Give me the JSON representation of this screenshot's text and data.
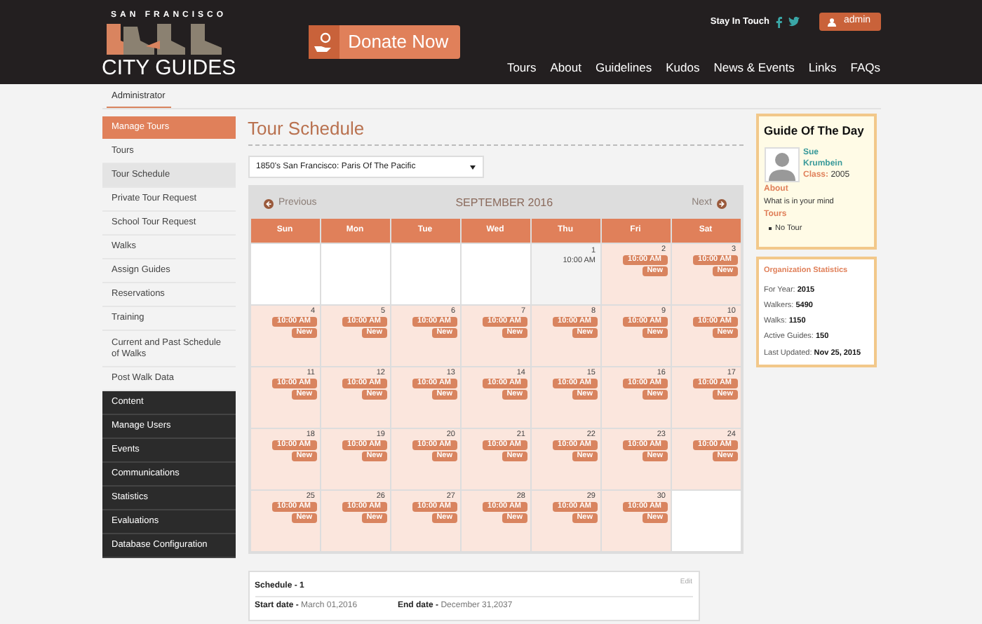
{
  "header": {
    "logo_top": "SAN FRANCISCO",
    "logo_bottom": "CITY GUIDES",
    "donate": "Donate Now",
    "stay_in_touch": "Stay In Touch",
    "user": "admin",
    "nav": [
      "Tours",
      "About",
      "Guidelines",
      "Kudos",
      "News & Events",
      "Links",
      "FAQs"
    ]
  },
  "breadcrumb_tab": "Administrator",
  "sidebar": [
    {
      "label": "Manage Tours",
      "kind": "heading"
    },
    {
      "label": "Tours",
      "kind": "sub",
      "selected": false
    },
    {
      "label": "Tour Schedule",
      "kind": "sub",
      "selected": true
    },
    {
      "label": "Private Tour Request",
      "kind": "sub",
      "selected": false
    },
    {
      "label": "School Tour Request",
      "kind": "sub",
      "selected": false
    },
    {
      "label": "Walks",
      "kind": "sub",
      "selected": false
    },
    {
      "label": "Assign Guides",
      "kind": "sub",
      "selected": false
    },
    {
      "label": "Reservations",
      "kind": "sub",
      "selected": false
    },
    {
      "label": "Training",
      "kind": "sub",
      "selected": false
    },
    {
      "label": "Current and Past Schedule of Walks",
      "kind": "sub",
      "selected": false
    },
    {
      "label": "Post Walk Data",
      "kind": "sub",
      "selected": false
    },
    {
      "label": "Content",
      "kind": "section"
    },
    {
      "label": "Manage Users",
      "kind": "section"
    },
    {
      "label": "Events",
      "kind": "section"
    },
    {
      "label": "Communications",
      "kind": "section"
    },
    {
      "label": "Statistics",
      "kind": "section"
    },
    {
      "label": "Evaluations",
      "kind": "section"
    },
    {
      "label": "Database Configuration",
      "kind": "section"
    }
  ],
  "title": "Tour Schedule",
  "tour_select": {
    "value": "1850's San Francisco: Paris Of The Pacific"
  },
  "calendar": {
    "previous": "Previous",
    "month": "SEPTEMBER 2016",
    "next": "Next",
    "weekdays": [
      "Sun",
      "Mon",
      "Tue",
      "Wed",
      "Thu",
      "Fri",
      "Sat"
    ],
    "weeks": [
      [
        {
          "kind": "blank"
        },
        {
          "kind": "blank"
        },
        {
          "kind": "blank"
        },
        {
          "kind": "blank"
        },
        {
          "kind": "plain",
          "day": "1",
          "time": "10:00 AM"
        },
        {
          "kind": "event",
          "day": "2",
          "time": "10:00 AM",
          "badge": "New"
        },
        {
          "kind": "event",
          "day": "3",
          "time": "10:00 AM",
          "badge": "New"
        }
      ],
      [
        {
          "kind": "event",
          "day": "4",
          "time": "10:00 AM",
          "badge": "New"
        },
        {
          "kind": "event",
          "day": "5",
          "time": "10:00 AM",
          "badge": "New"
        },
        {
          "kind": "event",
          "day": "6",
          "time": "10:00 AM",
          "badge": "New"
        },
        {
          "kind": "event",
          "day": "7",
          "time": "10:00 AM",
          "badge": "New"
        },
        {
          "kind": "event",
          "day": "8",
          "time": "10:00 AM",
          "badge": "New"
        },
        {
          "kind": "event",
          "day": "9",
          "time": "10:00 AM",
          "badge": "New"
        },
        {
          "kind": "event",
          "day": "10",
          "time": "10:00 AM",
          "badge": "New"
        }
      ],
      [
        {
          "kind": "event",
          "day": "11",
          "time": "10:00 AM",
          "badge": "New"
        },
        {
          "kind": "event",
          "day": "12",
          "time": "10:00 AM",
          "badge": "New"
        },
        {
          "kind": "event",
          "day": "13",
          "time": "10:00 AM",
          "badge": "New"
        },
        {
          "kind": "event",
          "day": "14",
          "time": "10:00 AM",
          "badge": "New"
        },
        {
          "kind": "event",
          "day": "15",
          "time": "10:00 AM",
          "badge": "New"
        },
        {
          "kind": "event",
          "day": "16",
          "time": "10:00 AM",
          "badge": "New"
        },
        {
          "kind": "event",
          "day": "17",
          "time": "10:00 AM",
          "badge": "New"
        }
      ],
      [
        {
          "kind": "event",
          "day": "18",
          "time": "10:00 AM",
          "badge": "New"
        },
        {
          "kind": "event",
          "day": "19",
          "time": "10:00 AM",
          "badge": "New"
        },
        {
          "kind": "event",
          "day": "20",
          "time": "10:00 AM",
          "badge": "New"
        },
        {
          "kind": "event",
          "day": "21",
          "time": "10:00 AM",
          "badge": "New"
        },
        {
          "kind": "event",
          "day": "22",
          "time": "10:00 AM",
          "badge": "New"
        },
        {
          "kind": "event",
          "day": "23",
          "time": "10:00 AM",
          "badge": "New"
        },
        {
          "kind": "event",
          "day": "24",
          "time": "10:00 AM",
          "badge": "New"
        }
      ],
      [
        {
          "kind": "event",
          "day": "25",
          "time": "10:00 AM",
          "badge": "New"
        },
        {
          "kind": "event",
          "day": "26",
          "time": "10:00 AM",
          "badge": "New"
        },
        {
          "kind": "event",
          "day": "27",
          "time": "10:00 AM",
          "badge": "New"
        },
        {
          "kind": "event",
          "day": "28",
          "time": "10:00 AM",
          "badge": "New"
        },
        {
          "kind": "event",
          "day": "29",
          "time": "10:00 AM",
          "badge": "New"
        },
        {
          "kind": "event",
          "day": "30",
          "time": "10:00 AM",
          "badge": "New"
        },
        {
          "kind": "blank"
        }
      ]
    ]
  },
  "schedule": {
    "title": "Schedule - 1",
    "edit": "Edit",
    "start_label": "Start date -",
    "start_value": "March 01,2016",
    "end_label": "End date -",
    "end_value": "December 31,2037"
  },
  "guide_of_day": {
    "title": "Guide Of The Day",
    "first_name": "Sue",
    "last_name": "Krumbein",
    "class_label": "Class:",
    "class_value": "2005",
    "about_label": "About",
    "about_text": "What is in your mind",
    "tours_label": "Tours",
    "tours": [
      "No Tour"
    ]
  },
  "stats": {
    "title": "Organization Statistics",
    "rows": [
      {
        "label": "For Year:",
        "value": "2015"
      },
      {
        "label": "Walkers:",
        "value": "5490"
      },
      {
        "label": "Walks:",
        "value": "1150"
      },
      {
        "label": "Active Guides:",
        "value": "150"
      },
      {
        "label": "Last Updated:",
        "value": "Nov 25, 2015"
      }
    ]
  }
}
